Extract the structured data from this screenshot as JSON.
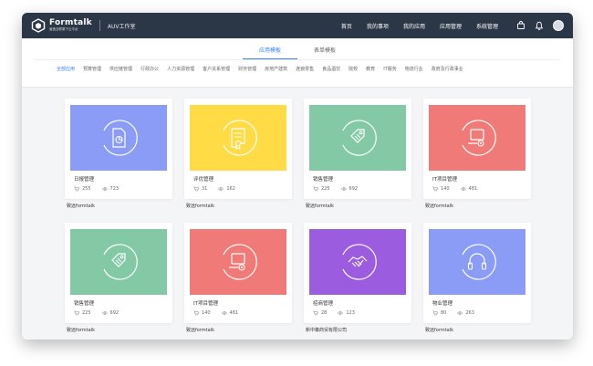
{
  "header": {
    "logo_name": "Formtalk",
    "logo_sub": "营造互联原下云平台",
    "workspace": "AUV工作室",
    "nav": [
      "首页",
      "我的事项",
      "我的应用",
      "应用管理",
      "系统管理"
    ]
  },
  "tabs": [
    {
      "label": "应用模板",
      "active": true
    },
    {
      "label": "表单模板",
      "active": false
    }
  ],
  "categories": [
    {
      "label": "全部应用",
      "active": true
    },
    {
      "label": "预算管理"
    },
    {
      "label": "供应链管理"
    },
    {
      "label": "行政办公"
    },
    {
      "label": "人力资源管理"
    },
    {
      "label": "客户关系管理"
    },
    {
      "label": "财务管理"
    },
    {
      "label": "房地产建筑"
    },
    {
      "label": "连锁零售"
    },
    {
      "label": "食品酒饮"
    },
    {
      "label": "院校"
    },
    {
      "label": "教育"
    },
    {
      "label": "IT服务"
    },
    {
      "label": "物流行业"
    },
    {
      "label": "政府及行政事业"
    }
  ],
  "cards": [
    {
      "title": "日报管理",
      "installs": "255",
      "views": "723",
      "author": "致远formtalk",
      "color": "#8a9cf5",
      "icon": "report-chart-icon"
    },
    {
      "title": "评优管理",
      "installs": "31",
      "views": "162",
      "author": "致远formtalk",
      "color": "#ffdc45",
      "icon": "certificate-icon"
    },
    {
      "title": "销售管理",
      "installs": "225",
      "views": "692",
      "author": "致远formtalk",
      "color": "#84c9a6",
      "icon": "price-tag-icon"
    },
    {
      "title": "IT项目管理",
      "installs": "140",
      "views": "481",
      "author": "致远formtalk",
      "color": "#f07a78",
      "icon": "laptop-gear-icon"
    },
    {
      "title": "销售管理",
      "installs": "225",
      "views": "692",
      "author": "致远formtalk",
      "color": "#84c9a6",
      "icon": "price-tag-icon"
    },
    {
      "title": "IT项目管理",
      "installs": "140",
      "views": "481",
      "author": "致远formtalk",
      "color": "#f07a78",
      "icon": "laptop-gear-icon"
    },
    {
      "title": "招商管理",
      "installs": "28",
      "views": "123",
      "author": "新中策商贸有限公司",
      "color": "#9b5ce0",
      "icon": "handshake-icon"
    },
    {
      "title": "物业管理",
      "installs": "80",
      "views": "263",
      "author": "致远formtalk",
      "color": "#8a9cf5",
      "icon": "headset-icon"
    }
  ]
}
